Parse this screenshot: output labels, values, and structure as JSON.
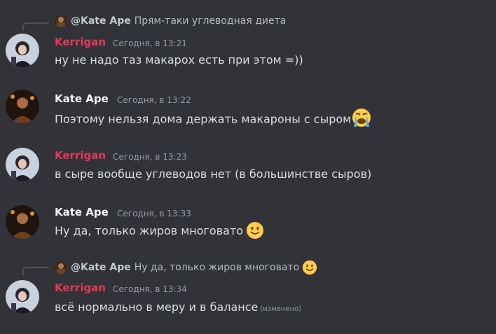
{
  "colors": {
    "background": "#313338",
    "kerrigan_name": "#e8375a",
    "kate_name": "#f2f3f5",
    "message_text": "#dbdee1",
    "timestamp": "#949ba4"
  },
  "messages": [
    {
      "author": "Kerrigan",
      "timestamp": "Сегодня, в 13:21",
      "text": "ну не надо таз макарох есть при этом =))",
      "reply": {
        "author": "@Kate Ape",
        "text": "Прям-таки углеводная диета"
      }
    },
    {
      "author": "Kate Ape",
      "timestamp": "Сегодня, в 13:22",
      "text": "Поэтому нельзя дома держать макароны с сыром",
      "emoji": "loudly-crying-face"
    },
    {
      "author": "Kerrigan",
      "timestamp": "Сегодня, в 13:23",
      "text": "в сыре вообще углеводов нет (в большинстве сыров)"
    },
    {
      "author": "Kate Ape",
      "timestamp": "Сегодня, в 13:33",
      "text": "Ну да, только жиров многовато",
      "emoji": "slightly-smiling-face"
    },
    {
      "author": "Kerrigan",
      "timestamp": "Сегодня, в 13:34",
      "text": "всё нормально в меру и в балансе",
      "edited": "(изменено)",
      "reply": {
        "author": "@Kate Ape",
        "text": "Ну да, только жиров многовато",
        "emoji": "slightly-smiling-face"
      }
    }
  ]
}
